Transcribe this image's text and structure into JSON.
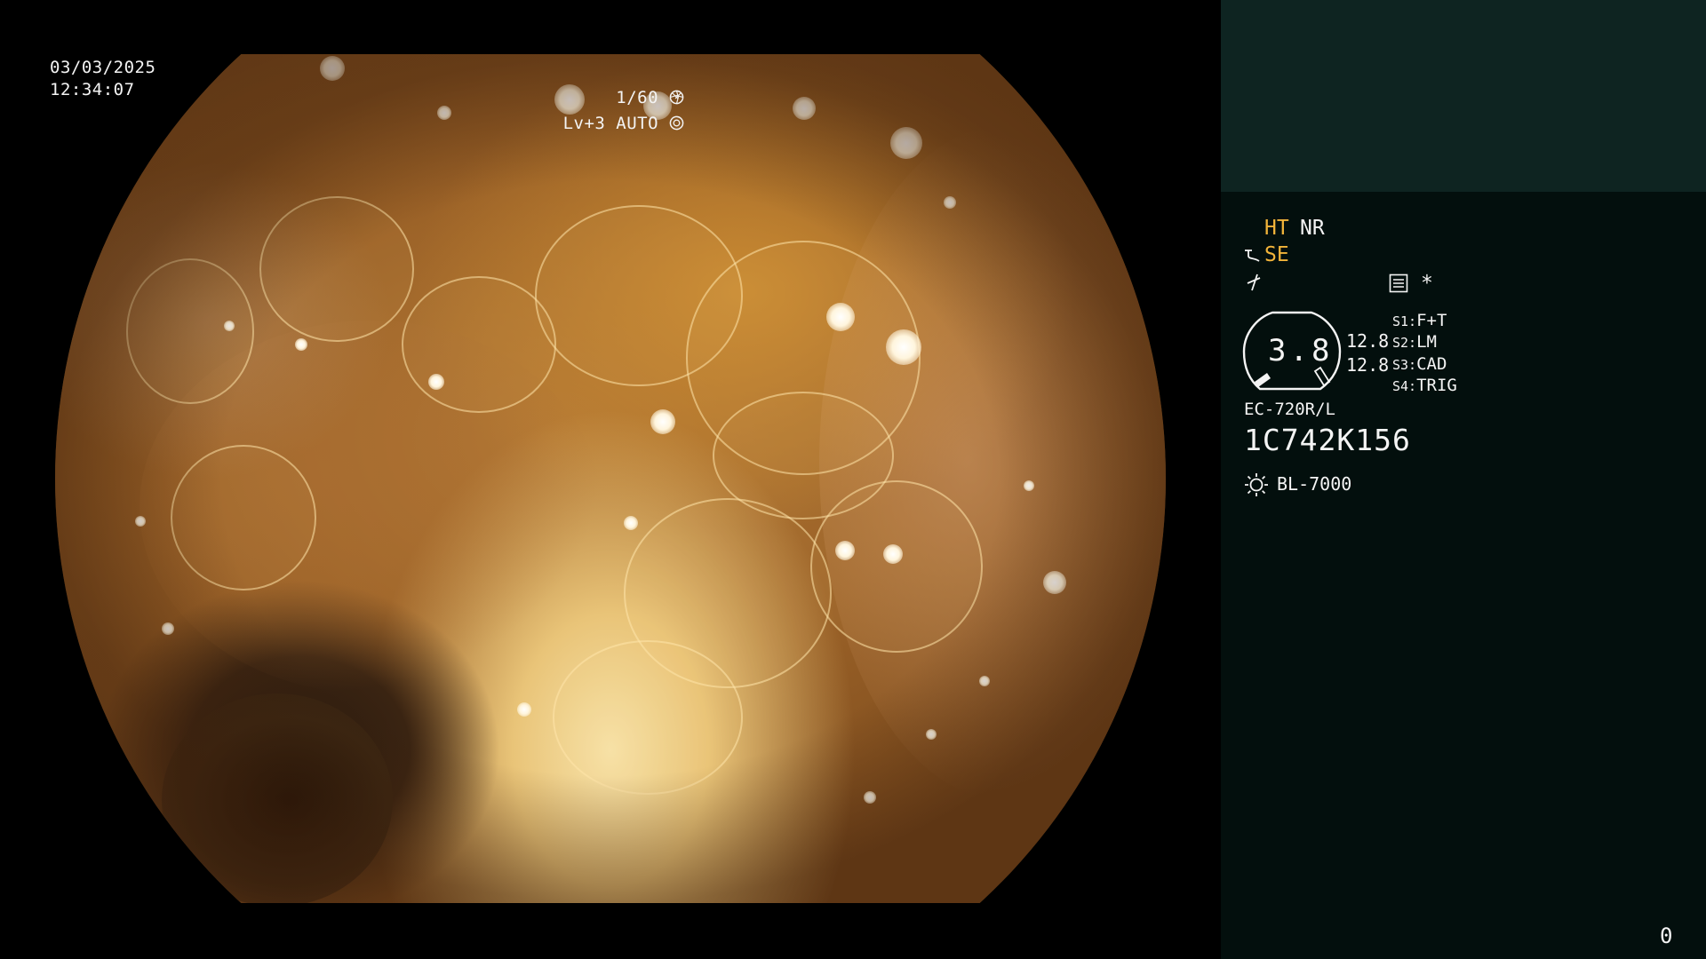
{
  "overlay": {
    "date": "03/03/2025",
    "time": "12:34:07",
    "shutter": "1/60",
    "shutter_icon": "aperture-icon",
    "level": "Lv+3 AUTO",
    "level_icon": "auto-iris-icon"
  },
  "panel": {
    "ht_label": "HT",
    "nr_label": "NR",
    "se_label": "SE",
    "se_icon": "enhance-curve-icon",
    "bolt_icon": "lightning-icon",
    "menu_icon": "list-icon",
    "asterisk": "*",
    "gauge_value": "3.8",
    "readout_top": "12.8",
    "readout_bottom": "12.8",
    "switches": [
      {
        "key": "S1:",
        "value": "F+T"
      },
      {
        "key": "S2:",
        "value": "LM"
      },
      {
        "key": "S3:",
        "value": "CAD"
      },
      {
        "key": "S4:",
        "value": "TRIG"
      }
    ],
    "scope_model": "EC-720R/L",
    "serial": "1C742K156",
    "light_source": "BL-7000",
    "light_icon": "sun-icon",
    "counter": "0"
  },
  "colors": {
    "panel_bg": "#030f0d",
    "panel_top_bg": "#0e2421",
    "accent_amber": "#f2b43a",
    "text": "#f4f4f4"
  }
}
